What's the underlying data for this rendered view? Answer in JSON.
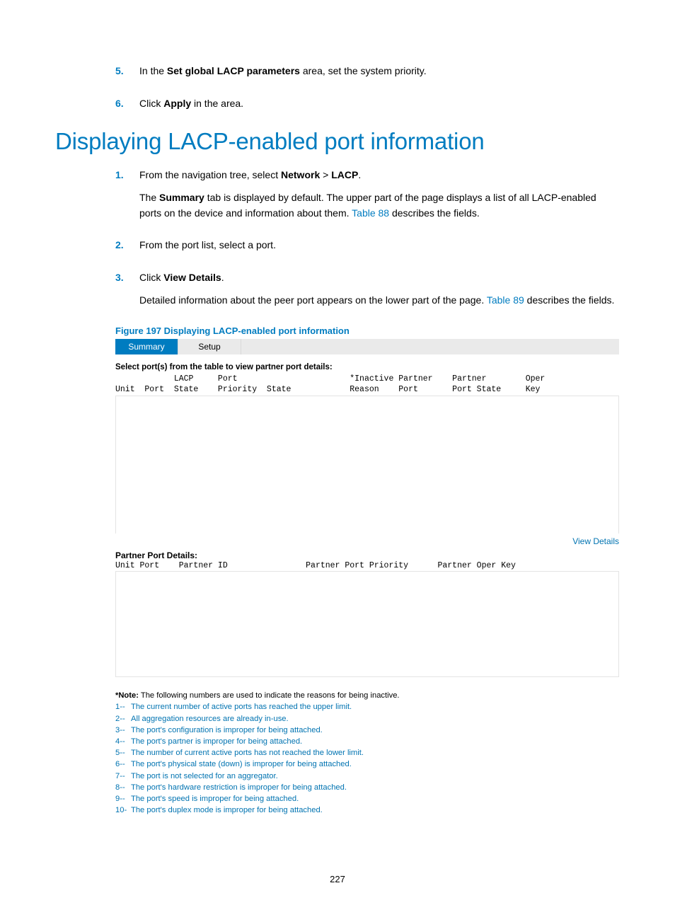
{
  "intro_steps": [
    {
      "n": "5.",
      "parts": [
        "In the ",
        {
          "b": "Set global LACP parameters"
        },
        " area, set the system priority."
      ]
    },
    {
      "n": "6.",
      "parts": [
        "Click ",
        {
          "b": "Apply"
        },
        " in the area."
      ]
    }
  ],
  "heading": "Displaying LACP-enabled port information",
  "steps": [
    {
      "n": "1.",
      "paragraphs": [
        [
          "From the navigation tree, select ",
          {
            "b": "Network"
          },
          " > ",
          {
            "b": "LACP"
          },
          "."
        ],
        [
          "The ",
          {
            "b": "Summary"
          },
          " tab is displayed by default. The upper part of the page displays a list of all LACP-enabled ports on the device and information about them. ",
          {
            "link": "Table 88"
          },
          " describes the fields."
        ]
      ]
    },
    {
      "n": "2.",
      "paragraphs": [
        [
          "From the port list, select a port."
        ]
      ]
    },
    {
      "n": "3.",
      "paragraphs": [
        [
          "Click ",
          {
            "b": "View Details"
          },
          "."
        ],
        [
          "Detailed information about the peer port appears on the lower part of the page. ",
          {
            "link": "Table 89"
          },
          " describes the fields."
        ]
      ]
    }
  ],
  "figure_caption": "Figure 197 Displaying LACP-enabled port information",
  "screenshot": {
    "tabs": [
      "Summary",
      "Setup"
    ],
    "active_tab": 0,
    "select_caption": "Select port(s) from the table to view partner port details:",
    "header_line1": "            LACP     Port                       *Inactive Partner    Partner        Oper",
    "header_line2": "Unit  Port  State    Priority  State            Reason    Port       Port State     Key",
    "view_details_label": "View Details",
    "ppd_label": "Partner Port Details:",
    "ppd_header": "Unit Port    Partner ID                Partner Port Priority      Partner Oper Key",
    "note_lead": "*Note: The following numbers are used to indicate the reasons for being inactive.",
    "notes": [
      {
        "n": "1--",
        "t": "The current number of active ports has reached the upper limit."
      },
      {
        "n": "2--",
        "t": "All aggregation resources are already in-use."
      },
      {
        "n": "3--",
        "t": "The port's configuration is improper for being attached."
      },
      {
        "n": "4--",
        "t": "The port's partner is improper for being attached."
      },
      {
        "n": "5--",
        "t": "The number of current active ports has not reached the lower limit."
      },
      {
        "n": "6--",
        "t": "The port's physical state (down) is improper for being attached."
      },
      {
        "n": "7--",
        "t": "The port is not selected for an aggregator."
      },
      {
        "n": "8--",
        "t": "The port's hardware restriction is improper for being attached."
      },
      {
        "n": "9--",
        "t": "The port's speed is improper for being attached."
      },
      {
        "n": "10-",
        "t": "The port's duplex mode is improper for being attached."
      }
    ]
  },
  "page_number": "227"
}
